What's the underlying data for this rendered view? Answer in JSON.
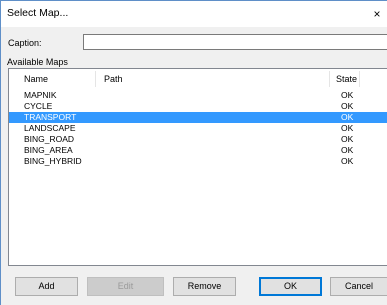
{
  "window": {
    "title": "Select Map...",
    "close_glyph": "×"
  },
  "caption": {
    "label": "Caption:",
    "value": ""
  },
  "available_maps": {
    "label": "Available Maps",
    "columns": [
      "Name",
      "Path",
      "State"
    ],
    "rows": [
      {
        "name": "MAPNIK",
        "path": "",
        "state": "OK",
        "selected": false
      },
      {
        "name": "CYCLE",
        "path": "",
        "state": "OK",
        "selected": false
      },
      {
        "name": "TRANSPORT",
        "path": "",
        "state": "OK",
        "selected": true
      },
      {
        "name": "LANDSCAPE",
        "path": "",
        "state": "OK",
        "selected": false
      },
      {
        "name": "BING_ROAD",
        "path": "",
        "state": "OK",
        "selected": false
      },
      {
        "name": "BING_AREA",
        "path": "",
        "state": "OK",
        "selected": false
      },
      {
        "name": "BING_HYBRID",
        "path": "",
        "state": "OK",
        "selected": false
      }
    ]
  },
  "buttons": {
    "add": "Add",
    "edit": "Edit",
    "remove": "Remove",
    "ok": "OK",
    "cancel": "Cancel"
  },
  "colors": {
    "selection": "#3399ff",
    "default_button_border": "#0078d7"
  }
}
